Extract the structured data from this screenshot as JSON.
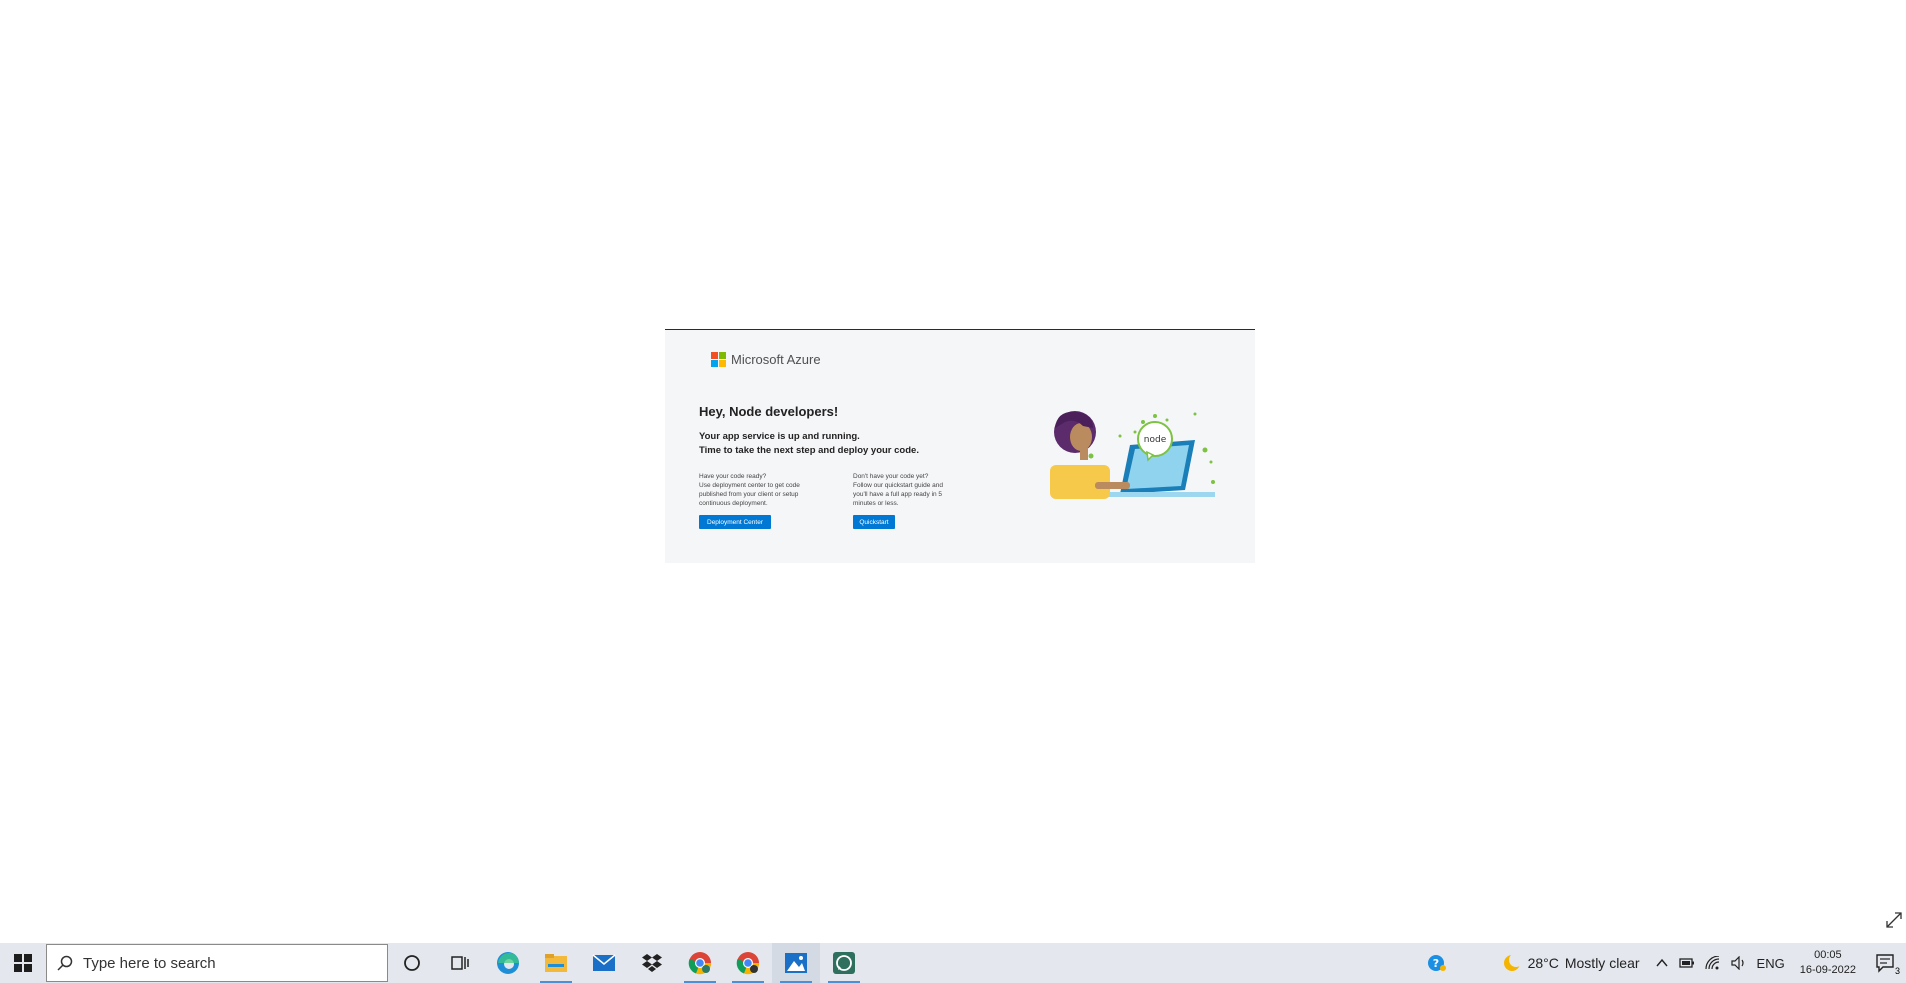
{
  "azure_page": {
    "logo_text": "Microsoft Azure",
    "heading": "Hey, Node developers!",
    "subheading_line1": "Your app service is up and running.",
    "subheading_line2": "Time to take the next step and deploy your code.",
    "col1_title": "Have your code ready?",
    "col1_line1": "Use deployment center to get code",
    "col1_line2": "published from your client or setup",
    "col1_line3": "continuous deployment.",
    "col1_button": "Deployment Center",
    "col2_title": "Don't have your code yet?",
    "col2_line1": "Follow our quickstart guide and",
    "col2_line2": "you'll have a full app ready in 5",
    "col2_line3": "minutes or less.",
    "col2_button": "Quickstart",
    "illustration_text": "node",
    "brand_color": "#0078d4"
  },
  "taskbar": {
    "search_placeholder": "Type here to search",
    "apps": [
      {
        "name": "cortana-icon"
      },
      {
        "name": "task-view-icon"
      },
      {
        "name": "edge-icon"
      },
      {
        "name": "file-explorer-icon"
      },
      {
        "name": "mail-icon"
      },
      {
        "name": "dropbox-icon"
      },
      {
        "name": "chrome-icon"
      },
      {
        "name": "chrome-profile-icon"
      },
      {
        "name": "photos-icon"
      },
      {
        "name": "whatsapp-icon"
      }
    ],
    "weather_temp": "28°C",
    "weather_desc": "Mostly clear",
    "language": "ENG",
    "time": "00:05",
    "date": "16-09-2022",
    "notification_count": "3"
  }
}
